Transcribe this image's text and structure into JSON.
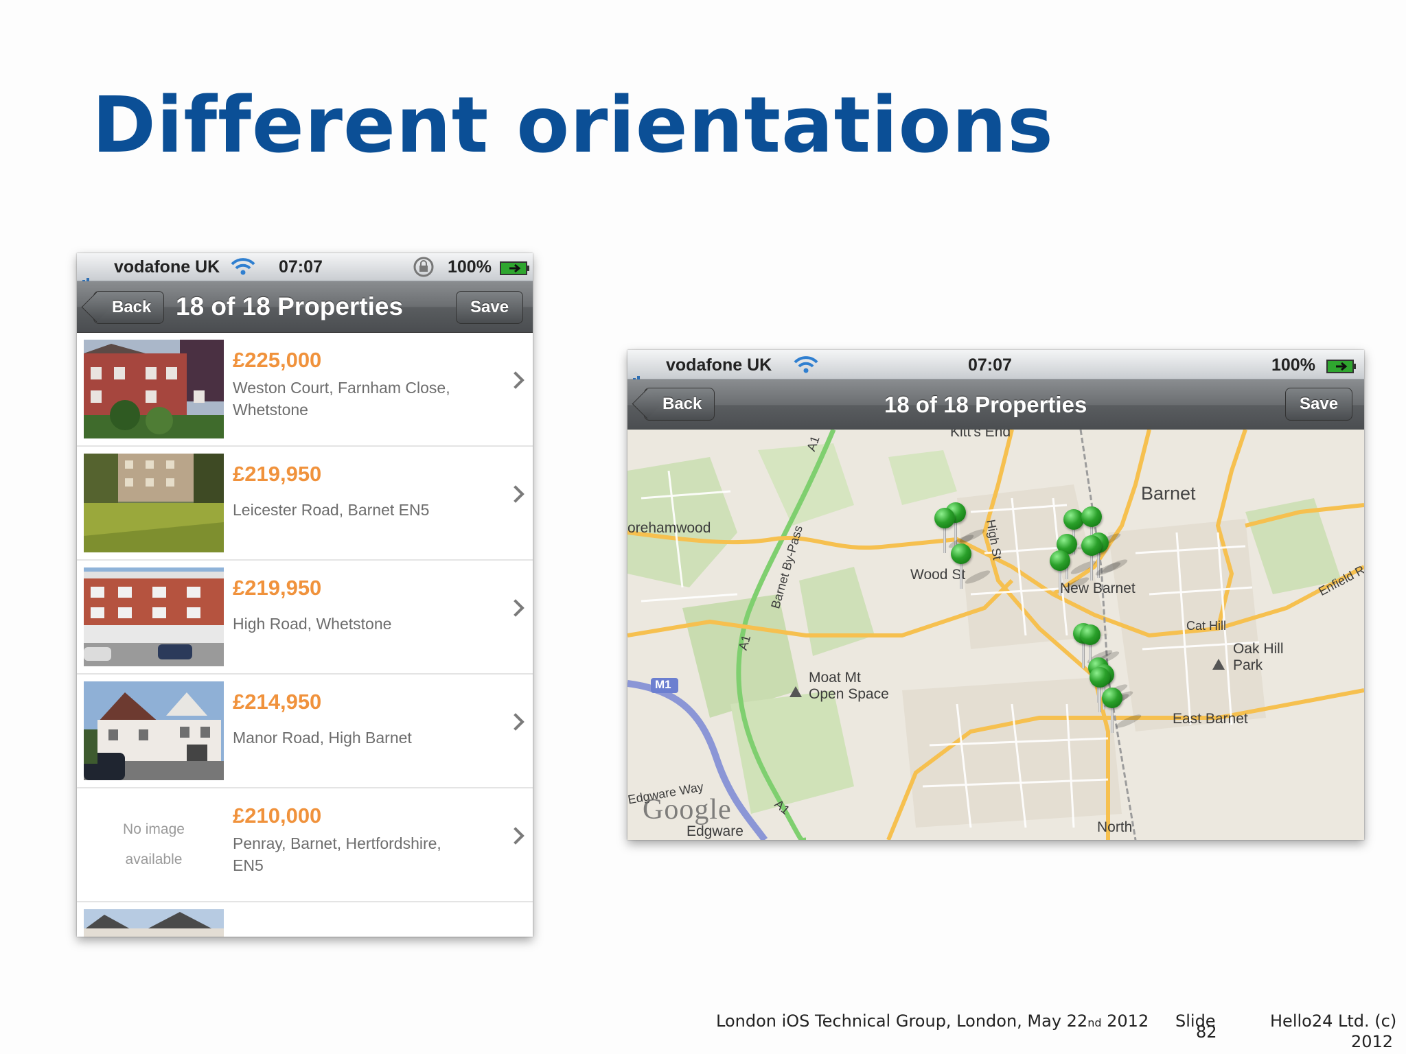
{
  "slide": {
    "title": "Different orientations",
    "footer_event_pre": "London iOS Technical Group, London, May 22",
    "footer_event_sup": "nd",
    "footer_event_post": " 2012",
    "footer_slide_label": "Slide",
    "footer_slide_number": "82",
    "footer_company_line1": "Hello24 Ltd. (c)",
    "footer_company_line2": "2012"
  },
  "portrait": {
    "status": {
      "carrier": "vodafone UK",
      "time": "07:07",
      "battery": "100%"
    },
    "nav": {
      "back_label": "Back",
      "title": "18 of 18 Properties",
      "save_label": "Save"
    },
    "listings": [
      {
        "price": "£225,000",
        "address_l1": "Weston Court, Farnham Close,",
        "address_l2": "Whetstone",
        "image": "brick-houses"
      },
      {
        "price": "£219,950",
        "address_l1": "Leicester Road, Barnet EN5",
        "address_l2": "",
        "image": "lawn-flats"
      },
      {
        "price": "£219,950",
        "address_l1": "High Road, Whetstone",
        "address_l2": "",
        "image": "shop-flats"
      },
      {
        "price": "£214,950",
        "address_l1": "Manor Road, High Barnet",
        "address_l2": "",
        "image": "tudor-house"
      },
      {
        "price": "£210,000",
        "address_l1": "Penray, Barnet, Hertfordshire,",
        "address_l2": "EN5",
        "image": "none",
        "no_image_l1": "No image",
        "no_image_l2": "available"
      }
    ]
  },
  "landscape": {
    "status": {
      "carrier": "vodafone UK",
      "time": "07:07",
      "battery": "100%"
    },
    "nav": {
      "back_label": "Back",
      "title": "18 of 18 Properties",
      "save_label": "Save"
    },
    "map": {
      "labels": {
        "kitts_end": "Kitt's End",
        "barnet": "Barnet",
        "borehamwood": "orehamwood",
        "wood_st": "Wood St",
        "high_st": "High St",
        "new_barnet": "New Barnet",
        "barnet_bypass": "Barnet By-Pass",
        "a1_top": "A1",
        "a1_mid": "A1",
        "a1_bottom": "A1",
        "cat_hill": "Cat Hill",
        "enfield": "Enfield R",
        "oak_hill": "Oak Hill",
        "park": "Park",
        "moat_mt": "Moat Mt",
        "open_space": "Open Space",
        "east_barnet": "East Barnet",
        "m1": "M1",
        "edgware_way": "Edgware Way",
        "edgware": "Edgware",
        "north": "North",
        "google": "Google"
      }
    }
  },
  "colors": {
    "title": "#0b4f96",
    "price": "#f0923c",
    "pin": "#2aa02a"
  }
}
